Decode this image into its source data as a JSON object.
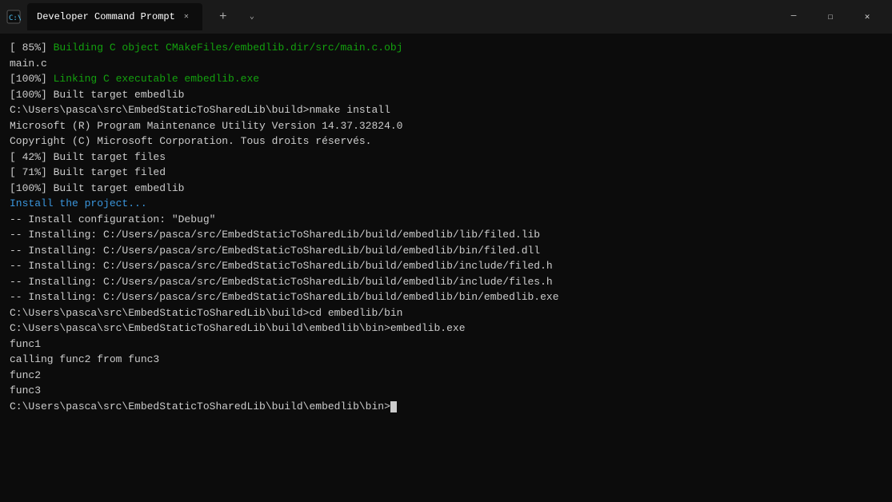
{
  "titlebar": {
    "icon": "⌨",
    "tab_label": "Developer Command Prompt",
    "tab_close": "✕",
    "add_label": "+",
    "dropdown_label": "˅",
    "wc_minimize": "─",
    "wc_maximize": "☐",
    "wc_close": "✕"
  },
  "terminal": {
    "lines": [
      {
        "id": 1,
        "parts": [
          {
            "text": "[ 85%] ",
            "class": "color-white"
          },
          {
            "text": "Building C object CMakeFiles/embedlib.dir/src/main.c.obj",
            "class": "color-green"
          }
        ]
      },
      {
        "id": 2,
        "parts": [
          {
            "text": "main.c",
            "class": "color-white"
          }
        ]
      },
      {
        "id": 3,
        "parts": [
          {
            "text": "[100%] ",
            "class": "color-white"
          },
          {
            "text": "Linking C executable embedlib.exe",
            "class": "color-green"
          }
        ]
      },
      {
        "id": 4,
        "parts": [
          {
            "text": "[100%] Built target embedlib",
            "class": "color-white"
          }
        ]
      },
      {
        "id": 5,
        "parts": [
          {
            "text": "",
            "class": ""
          }
        ]
      },
      {
        "id": 6,
        "parts": [
          {
            "text": "C:\\Users\\pasca\\src\\EmbedStaticToSharedLib\\build>nmake install",
            "class": "color-white"
          }
        ]
      },
      {
        "id": 7,
        "parts": [
          {
            "text": "",
            "class": ""
          }
        ]
      },
      {
        "id": 8,
        "parts": [
          {
            "text": "Microsoft (R) Program Maintenance Utility Version 14.37.32824.0",
            "class": "color-white"
          }
        ]
      },
      {
        "id": 9,
        "parts": [
          {
            "text": "Copyright (C) Microsoft Corporation. Tous droits réservés.",
            "class": "color-white"
          }
        ]
      },
      {
        "id": 10,
        "parts": [
          {
            "text": "",
            "class": ""
          }
        ]
      },
      {
        "id": 11,
        "parts": [
          {
            "text": "[ 42%] Built target files",
            "class": "color-white"
          }
        ]
      },
      {
        "id": 12,
        "parts": [
          {
            "text": "[ 71%] Built target filed",
            "class": "color-white"
          }
        ]
      },
      {
        "id": 13,
        "parts": [
          {
            "text": "[100%] Built target embedlib",
            "class": "color-white"
          }
        ]
      },
      {
        "id": 14,
        "parts": [
          {
            "text": "Install the project...",
            "class": "color-cyan"
          }
        ]
      },
      {
        "id": 15,
        "parts": [
          {
            "text": "-- Install configuration: \"Debug\"",
            "class": "color-white"
          }
        ]
      },
      {
        "id": 16,
        "parts": [
          {
            "text": "-- Installing: C:/Users/pasca/src/EmbedStaticToSharedLib/build/embedlib/lib/filed.lib",
            "class": "color-white"
          }
        ]
      },
      {
        "id": 17,
        "parts": [
          {
            "text": "-- Installing: C:/Users/pasca/src/EmbedStaticToSharedLib/build/embedlib/bin/filed.dll",
            "class": "color-white"
          }
        ]
      },
      {
        "id": 18,
        "parts": [
          {
            "text": "-- Installing: C:/Users/pasca/src/EmbedStaticToSharedLib/build/embedlib/include/filed.h",
            "class": "color-white"
          }
        ]
      },
      {
        "id": 19,
        "parts": [
          {
            "text": "-- Installing: C:/Users/pasca/src/EmbedStaticToSharedLib/build/embedlib/include/files.h",
            "class": "color-white"
          }
        ]
      },
      {
        "id": 20,
        "parts": [
          {
            "text": "-- Installing: C:/Users/pasca/src/EmbedStaticToSharedLib/build/embedlib/bin/embedlib.exe",
            "class": "color-white"
          }
        ]
      },
      {
        "id": 21,
        "parts": [
          {
            "text": "",
            "class": ""
          }
        ]
      },
      {
        "id": 22,
        "parts": [
          {
            "text": "C:\\Users\\pasca\\src\\EmbedStaticToSharedLib\\build>cd embedlib/bin",
            "class": "color-white"
          }
        ]
      },
      {
        "id": 23,
        "parts": [
          {
            "text": "",
            "class": ""
          }
        ]
      },
      {
        "id": 24,
        "parts": [
          {
            "text": "C:\\Users\\pasca\\src\\EmbedStaticToSharedLib\\build\\embedlib\\bin>embedlib.exe",
            "class": "color-white"
          }
        ]
      },
      {
        "id": 25,
        "parts": [
          {
            "text": "func1",
            "class": "color-white"
          }
        ]
      },
      {
        "id": 26,
        "parts": [
          {
            "text": "calling func2 from func3",
            "class": "color-white"
          }
        ]
      },
      {
        "id": 27,
        "parts": [
          {
            "text": "func2",
            "class": "color-white"
          }
        ]
      },
      {
        "id": 28,
        "parts": [
          {
            "text": "func3",
            "class": "color-white"
          }
        ]
      },
      {
        "id": 29,
        "parts": [
          {
            "text": "",
            "class": ""
          }
        ]
      },
      {
        "id": 30,
        "parts": [
          {
            "text": "C:\\Users\\pasca\\src\\EmbedStaticToSharedLib\\build\\embedlib\\bin>",
            "class": "color-white"
          },
          {
            "text": "CURSOR",
            "class": "cursor-marker"
          }
        ]
      }
    ]
  }
}
